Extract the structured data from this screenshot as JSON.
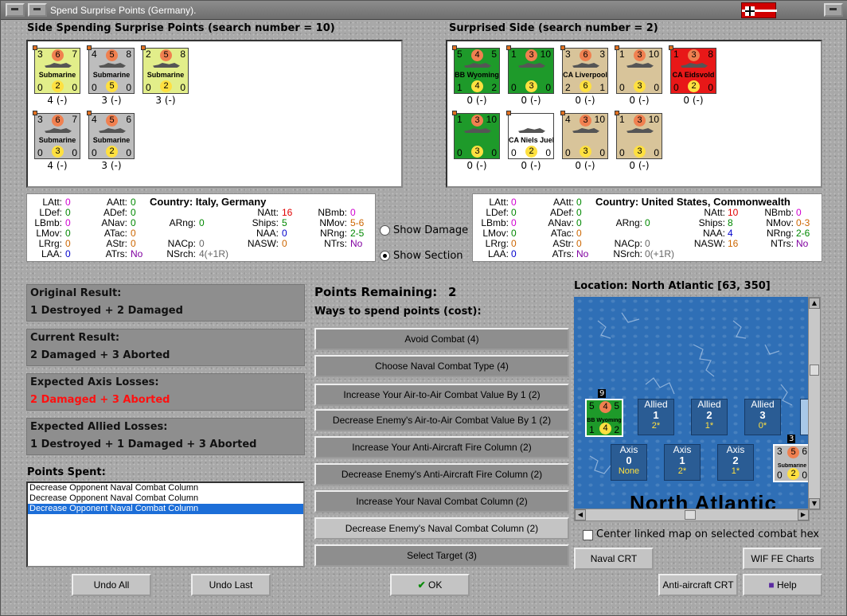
{
  "window": {
    "title": "Spend Surprise Points (Germany)."
  },
  "left": {
    "header": "Side Spending Surprise Points (search number = 10)",
    "units": [
      {
        "tl": "3",
        "c": "6",
        "tr": "7",
        "name": "Submarine",
        "bl": "0",
        "b": "2",
        "br": "0",
        "bg": "#e2ee8a",
        "sub": "4 (-)"
      },
      {
        "tl": "4",
        "c": "5",
        "tr": "8",
        "name": "Submarine",
        "bl": "0",
        "b": "5",
        "br": "0",
        "bg": "#bdbdbd",
        "sub": "3 (-)"
      },
      {
        "tl": "2",
        "c": "5",
        "tr": "8",
        "name": "Submarine",
        "bl": "0",
        "b": "2",
        "br": "0",
        "bg": "#e2ee8a",
        "sub": "3 (-)"
      },
      {
        "tl": "3",
        "c": "6",
        "tr": "7",
        "name": "Submarine",
        "bl": "0",
        "b": "3",
        "br": "0",
        "bg": "#bdbdbd",
        "sub": "4 (-)"
      },
      {
        "tl": "4",
        "c": "5",
        "tr": "6",
        "name": "Submarine",
        "bl": "0",
        "b": "2",
        "br": "0",
        "bg": "#bdbdbd",
        "sub": "3 (-)"
      }
    ]
  },
  "right": {
    "header": "Surprised Side (search number = 2)",
    "units": [
      {
        "tl": "5",
        "c": "4",
        "tr": "5",
        "name": "BB Wyoming",
        "bl": "1",
        "b": "4",
        "br": "2",
        "bg": "#1e9a2a",
        "sub": "0 (-)"
      },
      {
        "tl": "1",
        "c": "3",
        "tr": "10",
        "name": "",
        "bl": "0",
        "b": "3",
        "br": "0",
        "bg": "#1e9a2a",
        "sub": "0 (-)"
      },
      {
        "tl": "3",
        "c": "6",
        "tr": "3",
        "name": "CA Liverpool",
        "bl": "2",
        "b": "6",
        "br": "1",
        "bg": "#d8c49a",
        "sub": "0 (-)"
      },
      {
        "tl": "1",
        "c": "3",
        "tr": "10",
        "name": "",
        "bl": "0",
        "b": "3",
        "br": "0",
        "bg": "#d8c49a",
        "sub": "0 (-)"
      },
      {
        "tl": "1",
        "c": "3",
        "tr": "8",
        "name": "CA Eidsvold",
        "bl": "0",
        "b": "2",
        "br": "0",
        "bg": "#e81818",
        "sub": "0 (-)"
      },
      {
        "tl": "1",
        "c": "3",
        "tr": "10",
        "name": "",
        "bl": "0",
        "b": "3",
        "br": "0",
        "bg": "#1e9a2a",
        "sub": "0 (-)"
      },
      {
        "tl": "",
        "c": "",
        "tr": "",
        "name": "CA Niels Juel",
        "bl": "0",
        "b": "2",
        "br": "0",
        "bg": "#ffffff",
        "sub": "0 (-)"
      },
      {
        "tl": "4",
        "c": "3",
        "tr": "10",
        "name": "",
        "bl": "0",
        "b": "3",
        "br": "0",
        "bg": "#d8c49a",
        "sub": "0 (-)"
      },
      {
        "tl": "1",
        "c": "3",
        "tr": "10",
        "name": "",
        "bl": "0",
        "b": "3",
        "br": "0",
        "bg": "#d8c49a",
        "sub": "0 (-)"
      }
    ]
  },
  "stats_left": {
    "latt_l": "LAtt:",
    "latt": "0",
    "ldef_l": "LDef:",
    "ldef": "0",
    "lbmb_l": "LBmb:",
    "lbmb": "0",
    "lmov_l": "LMov:",
    "lmov": "0",
    "lrrg_l": "LRrg:",
    "lrrg": "0",
    "laa_l": "LAA:",
    "laa": "0",
    "aatt_l": "AAtt:",
    "aatt": "0",
    "adef_l": "ADef:",
    "adef": "0",
    "anav_l": "ANav:",
    "anav": "0",
    "atac_l": "ATac:",
    "atac": "0",
    "astr_l": "AStr:",
    "astr": "0",
    "atrs_l": "ATrs:",
    "atrs": "No",
    "country": "Country: Italy, Germany",
    "arng_l": "ARng:",
    "arng": "0",
    "nacp_l": "NACp:",
    "nacp": "0",
    "nsrch_l": "NSrch:",
    "nsrch": "4(+1R)",
    "natt_l": "NAtt:",
    "natt": "16",
    "ships_l": "Ships:",
    "ships": "5",
    "naa_l": "NAA:",
    "naa": "0",
    "nasw_l": "NASW:",
    "nasw": "0",
    "nbmb_l": "NBmb:",
    "nbmb": "0",
    "nmov_l": "NMov:",
    "nmov": "5-6",
    "nrng_l": "NRng:",
    "nrng": "2-5",
    "ntrs_l": "NTrs:",
    "ntrs": "No"
  },
  "stats_right": {
    "latt_l": "LAtt:",
    "latt": "0",
    "ldef_l": "LDef:",
    "ldef": "0",
    "lbmb_l": "LBmb:",
    "lbmb": "0",
    "lmov_l": "LMov:",
    "lmov": "0",
    "lrrg_l": "LRrg:",
    "lrrg": "0",
    "laa_l": "LAA:",
    "laa": "0",
    "aatt_l": "AAtt:",
    "aatt": "0",
    "adef_l": "ADef:",
    "adef": "0",
    "anav_l": "ANav:",
    "anav": "0",
    "atac_l": "ATac:",
    "atac": "0",
    "astr_l": "AStr:",
    "astr": "0",
    "atrs_l": "ATrs:",
    "atrs": "No",
    "country": "Country: United States, Commonwealth",
    "arng_l": "ARng:",
    "arng": "0",
    "nacp_l": "NACp:",
    "nacp": "0",
    "nsrch_l": "NSrch:",
    "nsrch": "0(+1R)",
    "natt_l": "NAtt:",
    "natt": "10",
    "ships_l": "Ships:",
    "ships": "8",
    "naa_l": "NAA:",
    "naa": "4",
    "nasw_l": "NASW:",
    "nasw": "16",
    "nbmb_l": "NBmb:",
    "nbmb": "0",
    "nmov_l": "NMov:",
    "nmov": "0-3",
    "nrng_l": "NRng:",
    "nrng": "2-6",
    "ntrs_l": "NTrs:",
    "ntrs": "No"
  },
  "options": {
    "show_damage": "Show Damage",
    "show_section": "Show Section",
    "selected": "show_section"
  },
  "results": {
    "original_label": "Original Result:",
    "original": "1 Destroyed + 2 Damaged",
    "current_label": "Current Result:",
    "current": "2 Damaged + 3 Aborted",
    "axis_label": "Expected Axis Losses:",
    "axis": "2 Damaged + 3 Aborted",
    "allied_label": "Expected Allied Losses:",
    "allied": "1 Destroyed + 1 Damaged + 3 Aborted"
  },
  "points_spent": {
    "label": "Points Spent:",
    "items": [
      "Decrease Opponent Naval Combat Column",
      "Decrease Opponent Naval Combat Column",
      "Decrease Opponent Naval Combat Column"
    ]
  },
  "spend": {
    "remaining_label": "Points Remaining:",
    "remaining": "2",
    "ways_label": "Ways to spend points (cost):",
    "options": [
      "Avoid Combat (4)",
      "Choose Naval Combat Type (4)",
      "Increase Your Air-to-Air Combat Value By 1 (2)",
      "Decrease Enemy's Air-to-Air Combat Value By 1 (2)",
      "Increase Your Anti-Aircraft Fire Column (2)",
      "Decrease Enemy's Anti-Aircraft Fire Column (2)",
      "Increase Your Naval Combat Column (2)",
      "Decrease Enemy's Naval Combat Column (2)",
      "Select Target (3)"
    ]
  },
  "map": {
    "location": "Location: North Atlantic [63, 350]",
    "region": "North Atlantic",
    "unit": {
      "tl": "5",
      "c": "4",
      "tr": "5",
      "name": "BB Wyoming",
      "bl": "1",
      "b": "4",
      "br": "2",
      "stack": "9"
    },
    "unit2": {
      "tl": "3",
      "c": "5",
      "tr": "6",
      "name": "Submarine",
      "bl": "0",
      "b": "2",
      "br": "0",
      "stack": "3"
    },
    "allied": [
      {
        "a": "Allied",
        "b": "1",
        "c": "2*"
      },
      {
        "a": "Allied",
        "b": "2",
        "c": "1*"
      },
      {
        "a": "Allied",
        "b": "3",
        "c": "0*"
      }
    ],
    "axis": [
      {
        "a": "Axis",
        "b": "0",
        "c": "None"
      },
      {
        "a": "Axis",
        "b": "1",
        "c": "2*"
      },
      {
        "a": "Axis",
        "b": "2",
        "c": "1*"
      }
    ],
    "center_label": "Center linked map on selected combat hex"
  },
  "buttons": {
    "undo_all": "Undo All",
    "undo_last": "Undo Last",
    "ok": "OK",
    "naval_crt": "Naval CRT",
    "wif_charts": "WIF FE Charts",
    "aa_crt": "Anti-aircraft CRT",
    "help": "Help"
  },
  "colors": {
    "zero": "#d000d0",
    "green": "#008800",
    "blue": "#0000cc",
    "red": "#e00000",
    "orange": "#cc6600",
    "purple": "#8000a0",
    "gray": "#666666"
  }
}
